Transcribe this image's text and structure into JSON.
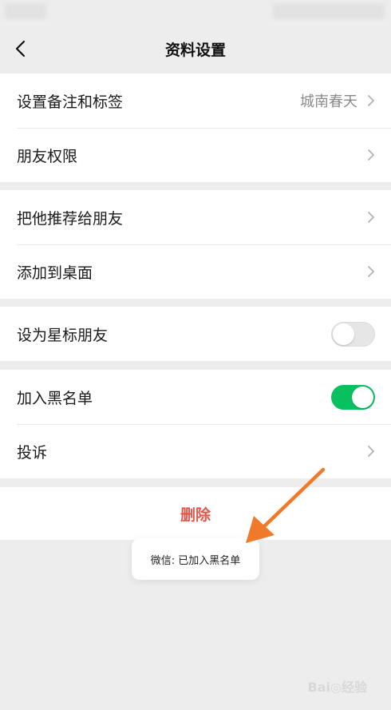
{
  "navbar": {
    "title": "资料设置"
  },
  "groups": {
    "remark": {
      "label": "设置备注和标签",
      "value": "城南春天"
    },
    "permission": {
      "label": "朋友权限"
    },
    "recommend": {
      "label": "把他推荐给朋友"
    },
    "desktop": {
      "label": "添加到桌面"
    },
    "star": {
      "label": "设为星标朋友",
      "toggle": "off"
    },
    "blacklist": {
      "label": "加入黑名单",
      "toggle": "on"
    },
    "complain": {
      "label": "投诉"
    }
  },
  "delete_label": "删除",
  "toast": {
    "text": "微信: 已加入黑名单"
  },
  "watermark": "Bai◎经验",
  "colors": {
    "accent_green": "#07c160",
    "danger_red": "#e1574c",
    "annotation_arrow": "#f07a2a"
  }
}
